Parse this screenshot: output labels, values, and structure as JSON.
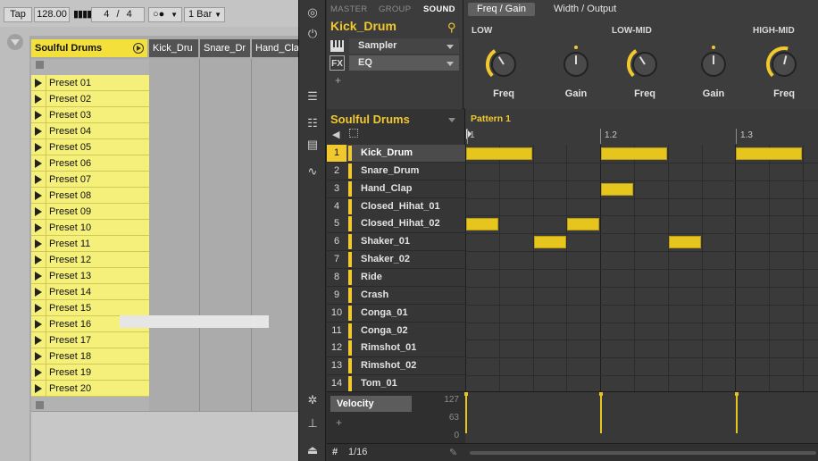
{
  "ableton": {
    "toolbar": {
      "tap": "Tap",
      "bpm": "128.00",
      "sig_num": "4",
      "sig_slash": "/",
      "sig_den": "4",
      "metro": "○●",
      "quant": "1 Bar"
    },
    "tracks": [
      "Soulful Drums",
      "Kick_Dru",
      "Snare_Dr",
      "Hand_Cla"
    ],
    "presets": [
      "Preset 01",
      "Preset 02",
      "Preset 03",
      "Preset 04",
      "Preset 05",
      "Preset 06",
      "Preset 07",
      "Preset 08",
      "Preset 09",
      "Preset 10",
      "Preset 11",
      "Preset 12",
      "Preset 13",
      "Preset 14",
      "Preset 15",
      "Preset 16",
      "Preset 17",
      "Preset 18",
      "Preset 19",
      "Preset 20"
    ],
    "colors": {
      "track": "#f3e03a",
      "clip": "#f5f07a"
    }
  },
  "maschine": {
    "tabs": {
      "master": "MASTER",
      "group": "GROUP",
      "sound": "SOUND"
    },
    "sound_name": "Kick_Drum",
    "modules": [
      {
        "icon": "piano-icon",
        "label": "Sampler"
      },
      {
        "icon": "FX",
        "label": "EQ"
      }
    ],
    "add": "+",
    "param_tabs": {
      "freq_gain": "Freq / Gain",
      "width_output": "Width / Output"
    },
    "sections": {
      "low": "LOW",
      "low_mid": "LOW-MID",
      "high_mid": "HIGH-MID"
    },
    "knob_labels": [
      "Freq",
      "Gain",
      "Freq",
      "Gain",
      "Freq"
    ],
    "group_name": "Soulful Drums",
    "pattern_name": "Pattern 1",
    "ruler": [
      "1",
      "1.2",
      "1.3"
    ],
    "sounds": [
      "Kick_Drum",
      "Snare_Drum",
      "Hand_Clap",
      "Closed_Hihat_01",
      "Closed_Hihat_02",
      "Shaker_01",
      "Shaker_02",
      "Ride",
      "Crash",
      "Conga_01",
      "Conga_02",
      "Rimshot_01",
      "Rimshot_02",
      "Tom_01"
    ],
    "sound_numbers": [
      "1",
      "2",
      "3",
      "4",
      "5",
      "6",
      "7",
      "8",
      "9",
      "10",
      "11",
      "12",
      "13",
      "14"
    ],
    "velocity": {
      "label": "Velocity",
      "max": "127",
      "mid": "63",
      "min": "0"
    },
    "grid": {
      "hash": "#",
      "value": "1/16"
    },
    "accent": "#f1c92f"
  }
}
